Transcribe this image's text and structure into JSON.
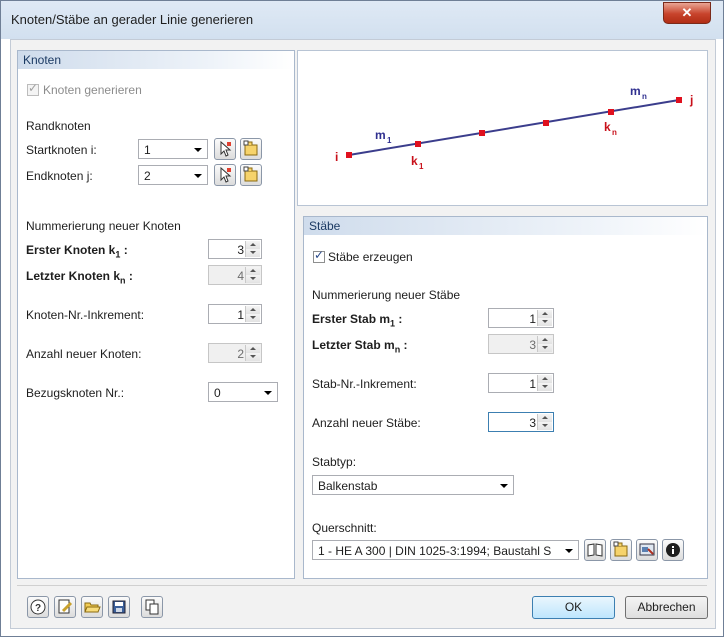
{
  "window": {
    "title": "Knoten/Stäbe an gerader Linie generieren",
    "close_glyph": "✕"
  },
  "knoten": {
    "header": "Knoten",
    "generate_label": "Knoten generieren",
    "randknoten_label": "Randknoten",
    "start_label": "Startknoten i:",
    "start_value": "1",
    "end_label": "Endknoten j:",
    "end_value": "2",
    "numbering_label": "Nummerierung neuer Knoten",
    "first_label": "Erster Knoten k",
    "first_sub": "1",
    "first_colon": " :",
    "first_value": "3",
    "last_label": "Letzter Knoten k",
    "last_sub": "n",
    "last_colon": " :",
    "last_value": "4",
    "increment_label": "Knoten-Nr.-Inkrement:",
    "increment_value": "1",
    "count_label": "Anzahl neuer Knoten:",
    "count_value": "2",
    "reference_label": "Bezugsknoten Nr.:",
    "reference_value": "0"
  },
  "diagram": {
    "label_i": "i",
    "label_j": "j",
    "label_m": "m",
    "sub_1": "1",
    "sub_n": "n",
    "label_k": "k",
    "line_color": "#3b3d8c",
    "node_color": "#e0101e",
    "label_color": "#2f2f8f",
    "node_label_color": "#c8101a"
  },
  "staebe": {
    "header": "Stäbe",
    "create_label": "Stäbe erzeugen",
    "numbering_label": "Nummerierung neuer Stäbe",
    "first_label": "Erster Stab m",
    "first_sub": "1",
    "first_colon": " :",
    "first_value": "1",
    "last_label": "Letzter Stab m",
    "last_sub": "n",
    "last_colon": " :",
    "last_value": "3",
    "increment_label": "Stab-Nr.-Inkrement:",
    "increment_value": "1",
    "count_label": "Anzahl neuer Stäbe:",
    "count_value": "3",
    "type_label": "Stabtyp:",
    "type_value": "Balkenstab",
    "section_label": "Querschnitt:",
    "section_value": "1 - HE A 300 | DIN 1025-3:1994; Baustahl S"
  },
  "footer": {
    "ok_label": "OK",
    "cancel_label": "Abbrechen"
  }
}
